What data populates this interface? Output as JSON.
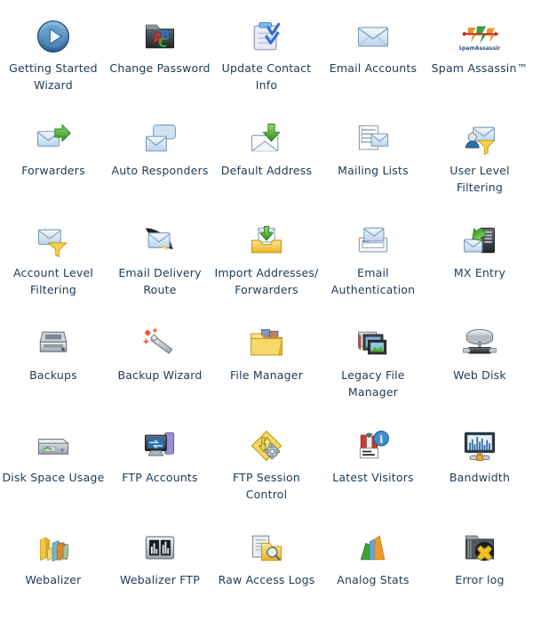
{
  "page": {
    "title": "cPanel Mail & Files Icon Grid",
    "background_color": "#ffffff",
    "label_color": "#1b3a57",
    "columns": 5,
    "rows": 6
  },
  "items": [
    {
      "label": "Getting Started Wizard",
      "icon": "play-circle-icon"
    },
    {
      "label": "Change Password",
      "icon": "folder-abc-icon"
    },
    {
      "label": "Update Contact Info",
      "icon": "clipboard-check-icon"
    },
    {
      "label": "Email Accounts",
      "icon": "envelope-icon"
    },
    {
      "label": "Spam Assassin™",
      "icon": "spamassassin-logo-icon"
    },
    {
      "label": "Forwarders",
      "icon": "envelope-arrow-icon"
    },
    {
      "label": "Auto Responders",
      "icon": "envelope-speech-icon"
    },
    {
      "label": "Default Address",
      "icon": "envelope-down-arrow-icon"
    },
    {
      "label": "Mailing Lists",
      "icon": "list-envelope-icon"
    },
    {
      "label": "User Level Filtering",
      "icon": "user-funnel-envelope-icon"
    },
    {
      "label": "Account Level Filtering",
      "icon": "envelope-funnel-icon"
    },
    {
      "label": "Email Delivery Route",
      "icon": "envelope-route-icon"
    },
    {
      "label": "Import Addresses/ Forwarders",
      "icon": "inbox-import-icon"
    },
    {
      "label": "Email Authentication",
      "icon": "envelope-form-icon"
    },
    {
      "label": "MX Entry",
      "icon": "server-envelope-icon"
    },
    {
      "label": "Backups",
      "icon": "tape-backup-icon"
    },
    {
      "label": "Backup Wizard",
      "icon": "backup-wand-icon"
    },
    {
      "label": "File Manager",
      "icon": "folder-photos-icon"
    },
    {
      "label": "Legacy File Manager",
      "icon": "photo-stack-icon"
    },
    {
      "label": "Web Disk",
      "icon": "network-disk-icon"
    },
    {
      "label": "Disk Space Usage",
      "icon": "hard-drive-icon"
    },
    {
      "label": "FTP Accounts",
      "icon": "monitor-transfer-icon"
    },
    {
      "label": "FTP Session Control",
      "icon": "diamond-gear-icon"
    },
    {
      "label": "Latest Visitors",
      "icon": "visitors-info-icon"
    },
    {
      "label": "Bandwidth",
      "icon": "bandwidth-graph-icon"
    },
    {
      "label": "Webalizer",
      "icon": "bar-chart-3d-icon"
    },
    {
      "label": "Webalizer FTP",
      "icon": "webalizer-ftp-icon"
    },
    {
      "label": "Raw Access Logs",
      "icon": "logs-magnifier-icon"
    },
    {
      "label": "Analog Stats",
      "icon": "analog-bars-icon"
    },
    {
      "label": "Error log",
      "icon": "folder-error-icon"
    }
  ],
  "icon_colors": {
    "blue": "#2f6fa8",
    "light_blue": "#c9dcef",
    "green": "#49a03a",
    "yellow": "#f0c53c",
    "orange": "#e8871f",
    "red": "#cf2b22",
    "gray": "#9aa3ab",
    "dark": "#3a3f45"
  }
}
